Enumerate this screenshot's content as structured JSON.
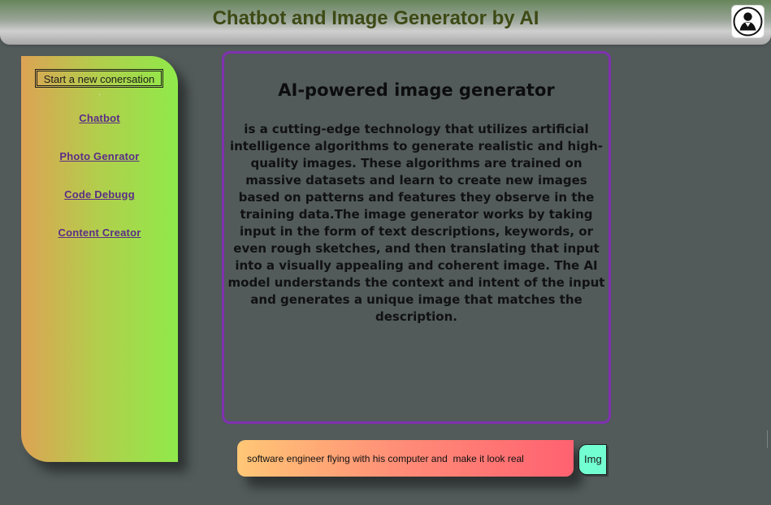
{
  "header": {
    "title": "Chatbot and Image Generator by AI",
    "profile_icon": "user-avatar-icon"
  },
  "sidebar": {
    "new_conversation_label": "Start a new conersation",
    "links": [
      {
        "label": "Chatbot"
      },
      {
        "label": "Photo Genrator"
      },
      {
        "label": "Code Debugg"
      },
      {
        "label": "Content Creator"
      }
    ]
  },
  "main": {
    "title": "AI-powered image generator",
    "description": "is a cutting-edge technology that utilizes artificial intelligence algorithms to generate realistic and high-quality images. These algorithms are trained on massive datasets and learn to create new images based on patterns and features they observe in the training data.The image generator works by taking input in the form of text descriptions, keywords, or even rough sketches, and then translating that input into a visually appealing and coherent image. The AI model understands the context and intent of the input and generates a unique image that matches the description."
  },
  "prompt": {
    "value": "software engineer flying with his computer and  make it look real",
    "button_label": "Img"
  },
  "colors": {
    "background": "#525a5a",
    "header_text": "#3d4a14",
    "panel_border": "#7f31b0",
    "sidebar_left": "#dda354",
    "sidebar_right": "#8fea4a",
    "link_text": "#5b2d87",
    "input_left": "#ffc776",
    "input_right": "#ff6170",
    "img_button": "#72ffd2"
  }
}
